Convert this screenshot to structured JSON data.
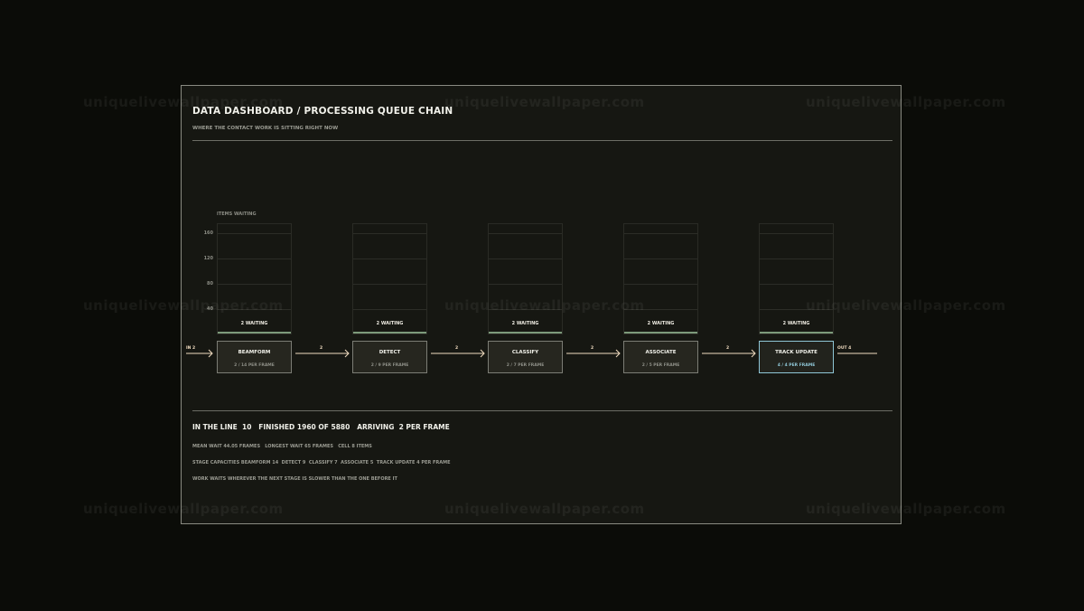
{
  "watermark": "uniquelivewallpaper.com",
  "header": {
    "title": "DATA DASHBOARD / PROCESSING QUEUE CHAIN",
    "subtitle": "WHERE THE CONTACT WORK IS SITTING RIGHT NOW"
  },
  "chart": {
    "ylabel": "ITEMS WAITING",
    "yticks": [
      "160",
      "120",
      "80",
      "40"
    ]
  },
  "flow": {
    "in_label": "IN 2",
    "out_label": "OUT 4",
    "between": [
      "2",
      "2",
      "2",
      "2"
    ]
  },
  "stages": [
    {
      "name": "BEAMFORM",
      "rate": "2 / 14 PER FRAME",
      "waiting": "2 WAITING",
      "queue": 2,
      "active": false
    },
    {
      "name": "DETECT",
      "rate": "2 / 9 PER FRAME",
      "waiting": "2 WAITING",
      "queue": 2,
      "active": false
    },
    {
      "name": "CLASSIFY",
      "rate": "2 / 7 PER FRAME",
      "waiting": "2 WAITING",
      "queue": 2,
      "active": false
    },
    {
      "name": "ASSOCIATE",
      "rate": "2 / 5 PER FRAME",
      "waiting": "2 WAITING",
      "queue": 2,
      "active": false
    },
    {
      "name": "TRACK UPDATE",
      "rate": "4 / 4 PER FRAME",
      "waiting": "2 WAITING",
      "queue": 2,
      "active": true
    }
  ],
  "summary": {
    "headline": "IN THE LINE  10   FINISHED 1960 OF 5880   ARRIVING  2 PER FRAME",
    "line1": "MEAN WAIT 44.05 FRAMES   LONGEST WAIT 65 FRAMES   CELL 8 ITEMS",
    "line2": "STAGE CAPACITIES BEAMFORM 14  DETECT 9  CLASSIFY 7  ASSOCIATE 5  TRACK UPDATE 4 PER FRAME",
    "line3": "WORK WAITS WHEREVER THE NEXT STAGE IS SLOWER THAN THE ONE BEFORE IT"
  },
  "colors": {
    "accent": "#8fc6d6",
    "arrow": "#f0dcc0",
    "queue_fill": "#7d9a7a"
  }
}
